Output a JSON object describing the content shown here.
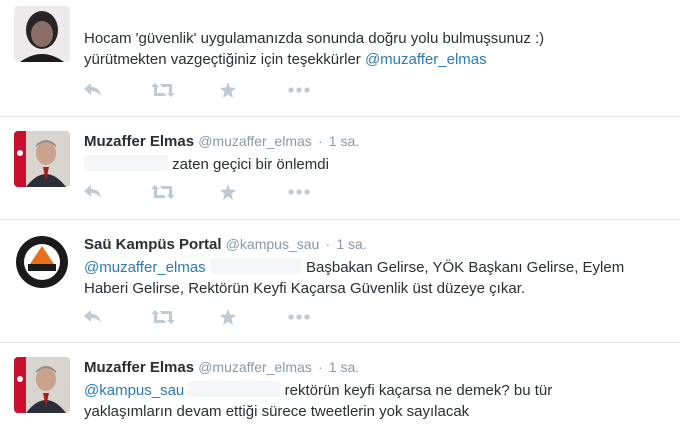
{
  "tweets": [
    {
      "fullname": "",
      "username": "",
      "time": "",
      "text_line1": "Hocam 'güvenlik' uygulamanızda sonunda doğru yolu bulmuşsunuz :)",
      "text_line2_pre": "yürütmekten vazgeçtiğiniz için teşekkürler ",
      "text_line2_mention": "@muzaffer_elmas"
    },
    {
      "fullname": "Muzaffer Elmas",
      "username": "@muzaffer_elmas",
      "separator": "·",
      "time": "1 sa.",
      "text": "zaten geçici bir önlemdi"
    },
    {
      "fullname": "Saü Kampüs Portal",
      "username": "@kampus_sau",
      "separator": "·",
      "time": "1 sa.",
      "mention": "@muzaffer_elmas",
      "text_line1": "Başbakan Gelirse, YÖK Başkanı Gelirse, Eylem",
      "text_line2": "Haberi Gelirse, Rektörün Keyfi Kaçarsa Güvenlik üst düzeye çıkar."
    },
    {
      "fullname": "Muzaffer Elmas",
      "username": "@muzaffer_elmas",
      "separator": "·",
      "time": "1 sa.",
      "mention": "@kampus_sau",
      "text_line1": "rektörün keyfi kaçarsa ne demek? bu tür",
      "text_line2": "yaklaşımların devam ettiği sürece tweetlerin yok sayılacak"
    }
  ],
  "icons": [
    "reply-icon",
    "retweet-icon",
    "favorite-icon",
    "more-icon"
  ],
  "colors": {
    "link": "#2b7bb9",
    "meta": "#8899a6",
    "text": "#292f33",
    "action": "#bfcad3",
    "divider": "#e1e8ed"
  }
}
